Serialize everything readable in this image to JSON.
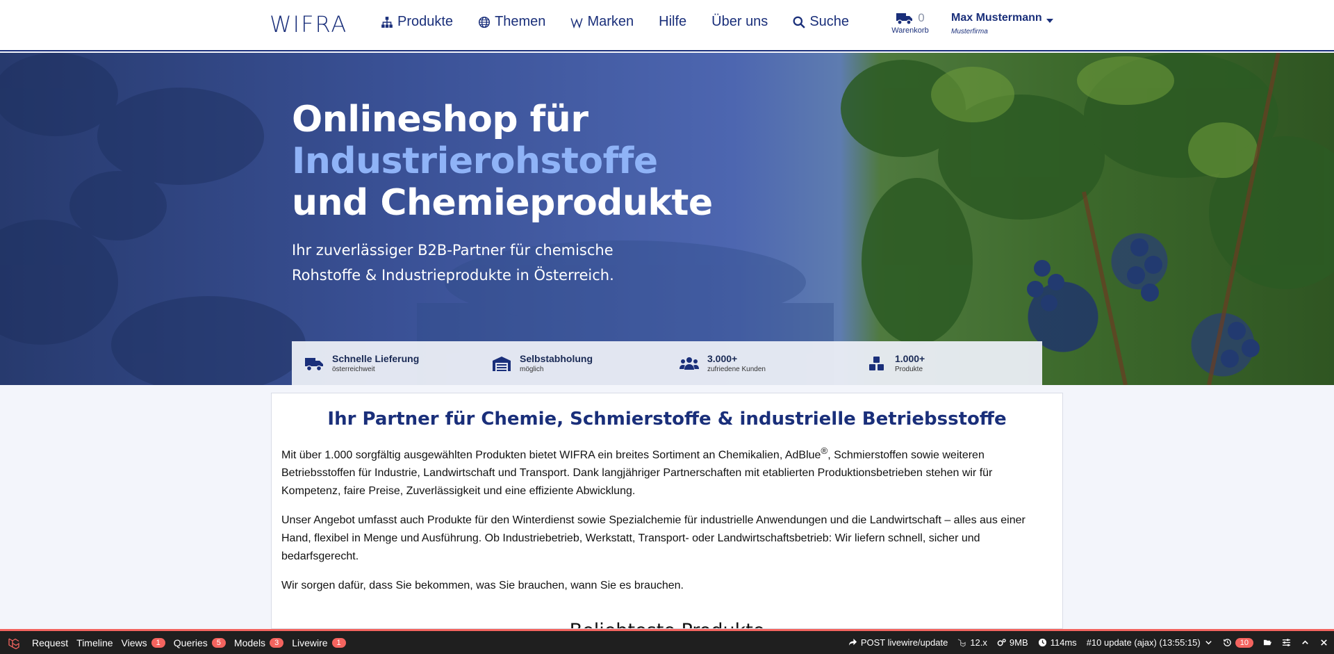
{
  "header": {
    "logo": "WIFRA",
    "nav": [
      {
        "label": "Produkte",
        "icon": "sitemap-icon"
      },
      {
        "label": "Themen",
        "icon": "globe-icon"
      },
      {
        "label": "Marken",
        "icon": "w-icon"
      },
      {
        "label": "Hilfe"
      },
      {
        "label": "Über uns"
      },
      {
        "label": "Suche",
        "icon": "search-icon"
      }
    ],
    "cart": {
      "count": "0",
      "label": "Warenkorb"
    },
    "user": {
      "name": "Max Mustermann",
      "company": "Musterfirma"
    }
  },
  "hero": {
    "title_line1": "Onlineshop für",
    "title_line2": "Industrierohstoffe",
    "title_line3": "und Chemieprodukte",
    "subtitle": "Ihr zuverlässiger B2B-Partner für chemische Rohstoffe & Industrieprodukte in Österreich.",
    "features": [
      {
        "title": "Schnelle Lieferung",
        "sub": "österreichweit",
        "icon": "truck-icon"
      },
      {
        "title": "Selbstabholung",
        "sub": "möglich",
        "icon": "warehouse-icon"
      },
      {
        "title": "3.000+",
        "sub": "zufriedene Kunden",
        "icon": "users-icon"
      },
      {
        "title": "1.000+",
        "sub": "Produkte",
        "icon": "boxes-icon"
      }
    ]
  },
  "content": {
    "heading": "Ihr Partner für Chemie, Schmierstoffe & industrielle Betriebsstoffe",
    "p1_before": "Mit über 1.000 sorgfältig ausgewählten Produkten bietet WIFRA ein breites Sortiment an Chemikalien, AdBlue",
    "p1_sup": "®",
    "p1_after": ", Schmierstoffen sowie weiteren Betriebsstoffen für Industrie, Landwirtschaft und Transport. Dank langjähriger Partnerschaften mit etablierten Produktionsbetrieben stehen wir für Kompetenz, faire Preise, Zuverlässigkeit und eine effiziente Abwicklung.",
    "p2": "Unser Angebot umfasst auch Produkte für den Winterdienst sowie Spezialchemie für industrielle Anwendungen und die Landwirtschaft – alles aus einer Hand, flexibel in Menge und Ausführung. Ob Industriebetrieb, Werkstatt, Transport- oder Landwirtschaftsbetrieb: Wir liefern schnell, sicher und bedarfsgerecht.",
    "p3": "Wir sorgen dafür, dass Sie bekommen, was Sie brauchen, wann Sie es brauchen.",
    "section_title": "Beliebteste Produkte"
  },
  "debugbar": {
    "tabs": [
      {
        "label": "Request"
      },
      {
        "label": "Timeline"
      },
      {
        "label": "Views",
        "badge": "1"
      },
      {
        "label": "Queries",
        "badge": "5"
      },
      {
        "label": "Models",
        "badge": "3"
      },
      {
        "label": "Livewire",
        "badge": "1"
      }
    ],
    "route": "POST livewire/update",
    "laravel_version": "12.x",
    "memory": "9MB",
    "time": "114ms",
    "request_select": "#10 update (ajax) (13:55:15)",
    "history_count": "10"
  },
  "colors": {
    "brand": "#1a2f7a",
    "accent": "#8fb3f7",
    "debug_red": "#f4645f"
  }
}
